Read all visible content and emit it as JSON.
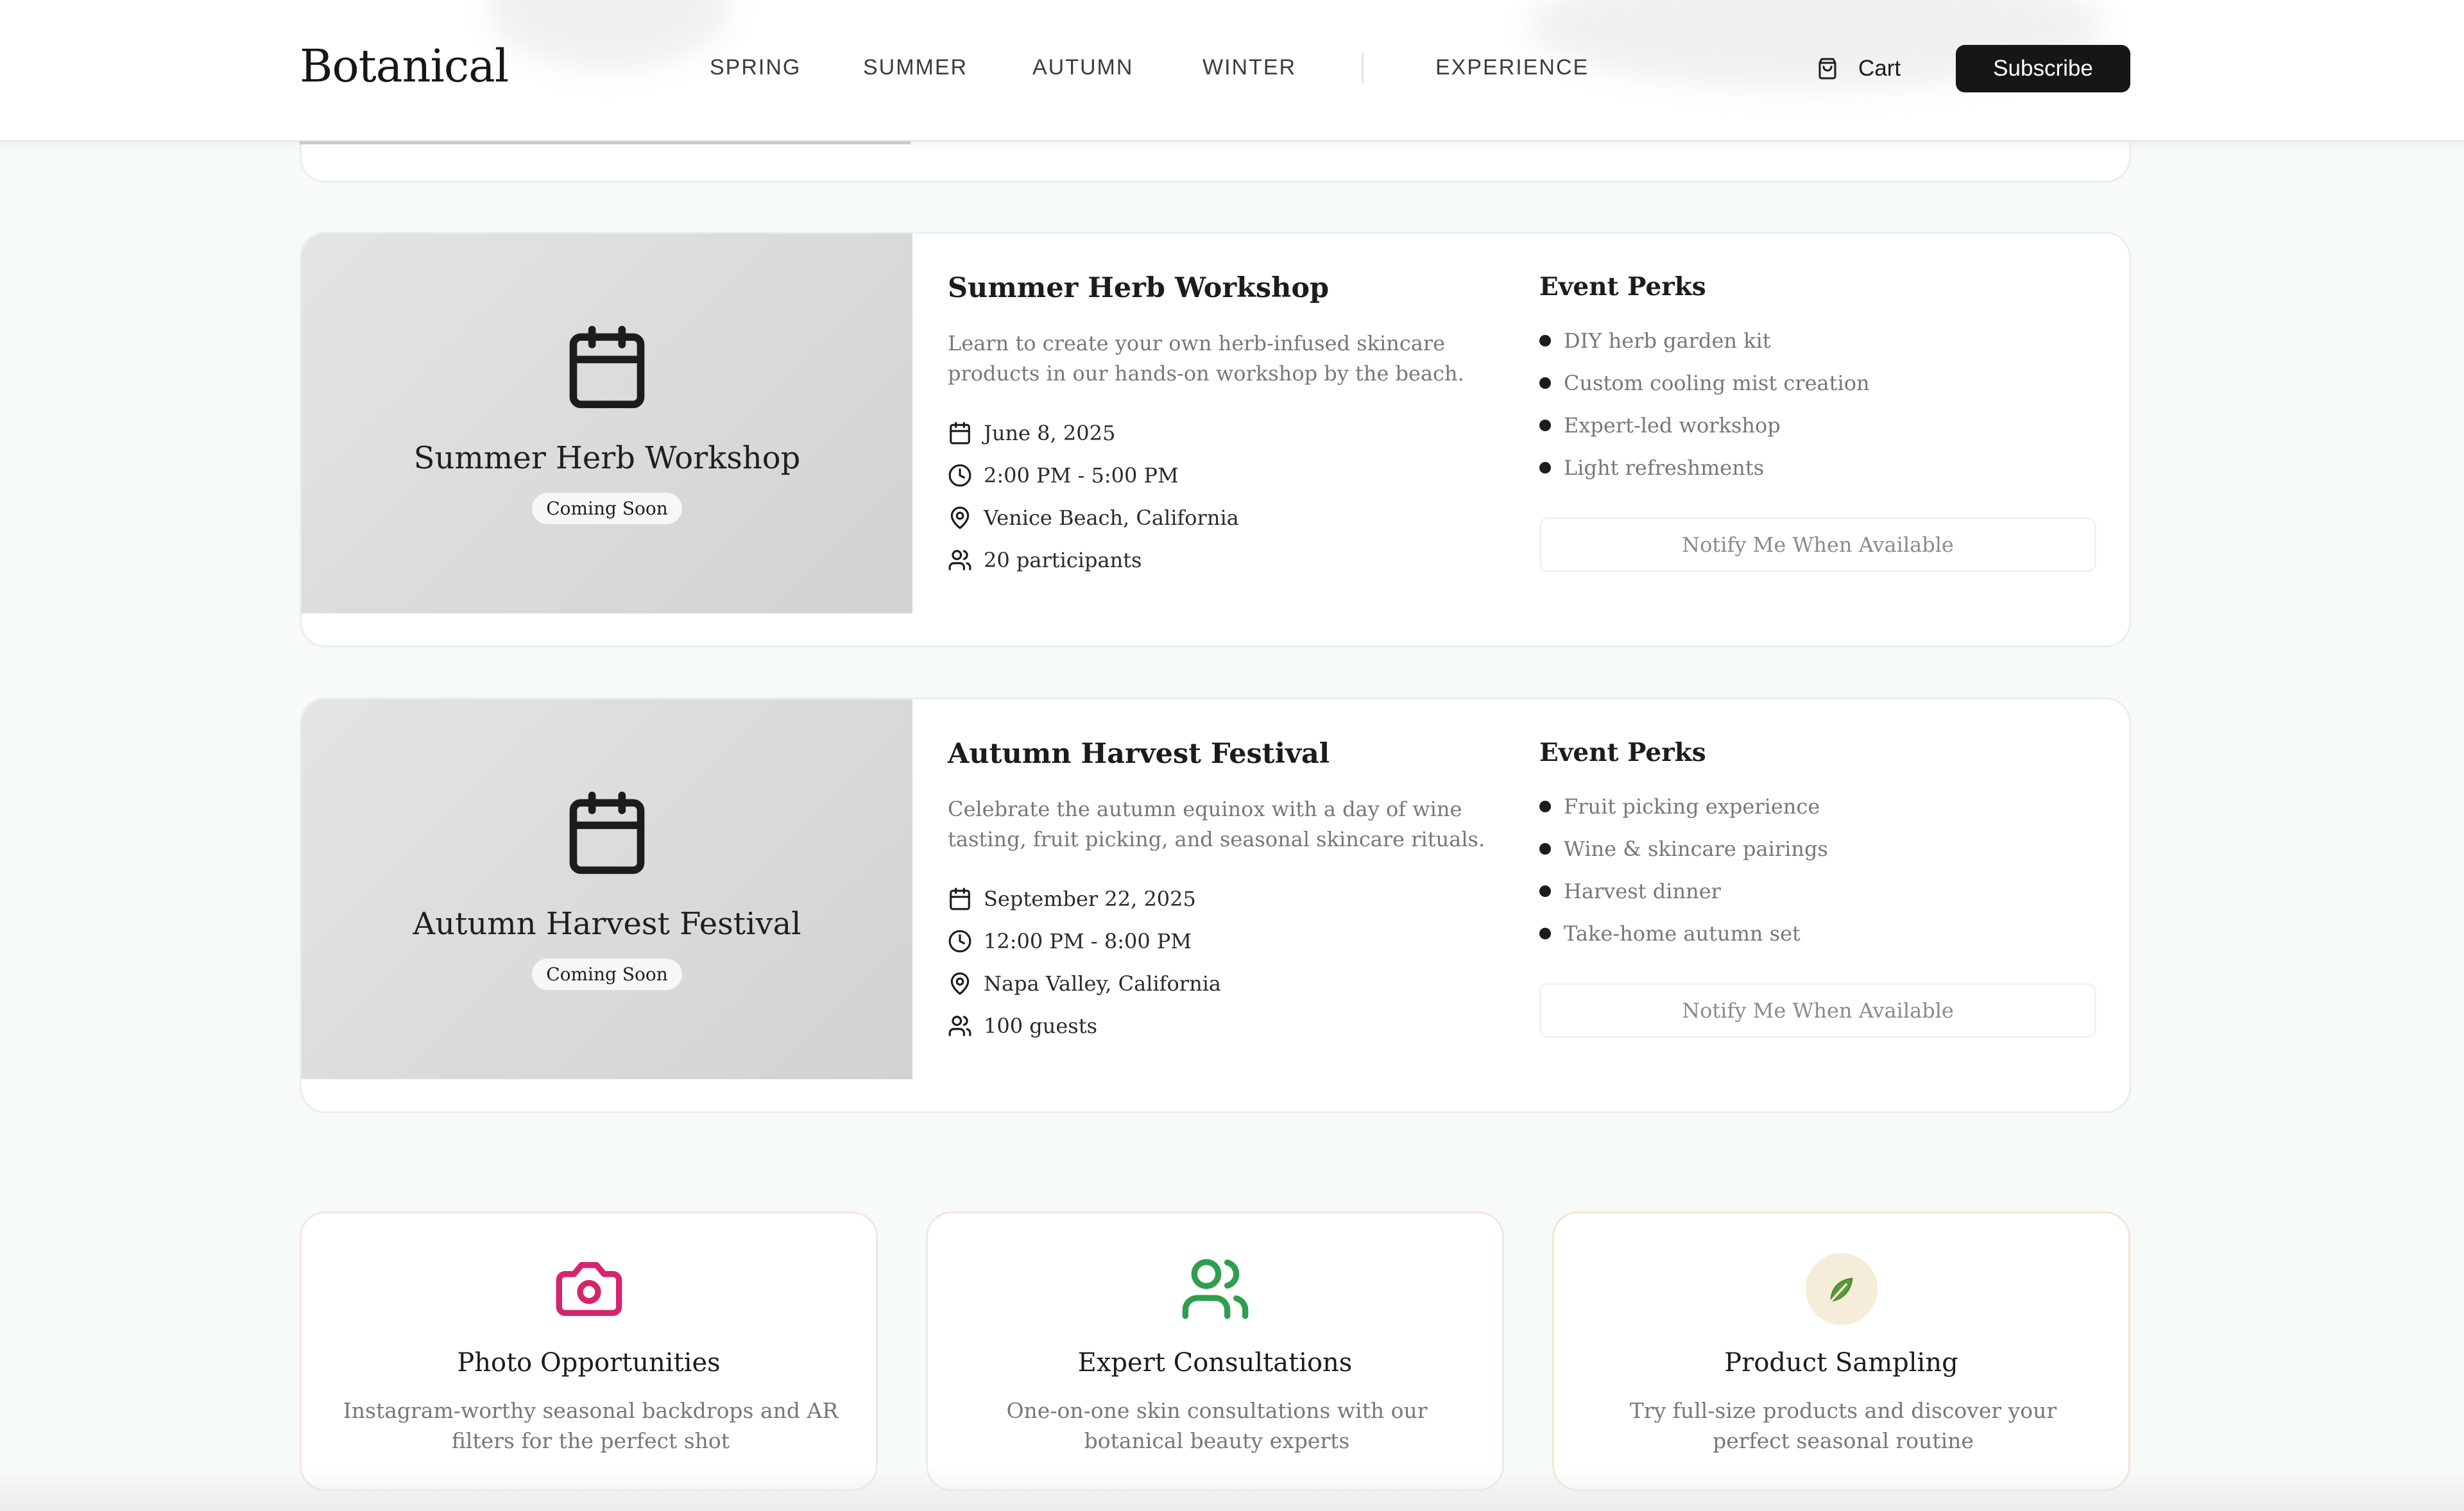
{
  "header": {
    "logo": "Botanical",
    "nav": [
      "SPRING",
      "SUMMER",
      "AUTUMN",
      "WINTER",
      "EXPERIENCE"
    ],
    "cart_label": "Cart",
    "subscribe_label": "Subscribe"
  },
  "events": [
    {
      "image_title": "Summer Herb Workshop",
      "badge": "Coming Soon",
      "title": "Summer Herb Workshop",
      "description": "Learn to create your own herb-infused skincare products in our hands-on workshop by the beach.",
      "date": "June 8, 2025",
      "time": "2:00 PM - 5:00 PM",
      "location": "Venice Beach, California",
      "capacity": "20 participants",
      "perks_title": "Event Perks",
      "perks": [
        "DIY herb garden kit",
        "Custom cooling mist creation",
        "Expert-led workshop",
        "Light refreshments"
      ],
      "notify_label": "Notify Me When Available"
    },
    {
      "image_title": "Autumn Harvest Festival",
      "badge": "Coming Soon",
      "title": "Autumn Harvest Festival",
      "description": "Celebrate the autumn equinox with a day of wine tasting, fruit picking, and seasonal skincare rituals.",
      "date": "September 22, 2025",
      "time": "12:00 PM - 8:00 PM",
      "location": "Napa Valley, California",
      "capacity": "100 guests",
      "perks_title": "Event Perks",
      "perks": [
        "Fruit picking experience",
        "Wine & skincare pairings",
        "Harvest dinner",
        "Take-home autumn set"
      ],
      "notify_label": "Notify Me When Available"
    }
  ],
  "features": [
    {
      "icon": "camera-icon",
      "color": "#d6246e",
      "title": "Photo Opportunities",
      "description": "Instagram-worthy seasonal backdrops and AR filters for the perfect shot"
    },
    {
      "icon": "users-icon",
      "color": "#2f9e4f",
      "title": "Expert Consultations",
      "description": "One-on-one skin consultations with our botanical beauty experts"
    },
    {
      "icon": "leaf-icon",
      "color": "#5a9a3a",
      "title": "Product Sampling",
      "description": "Try full-size products and discover your perfect seasonal routine"
    }
  ]
}
